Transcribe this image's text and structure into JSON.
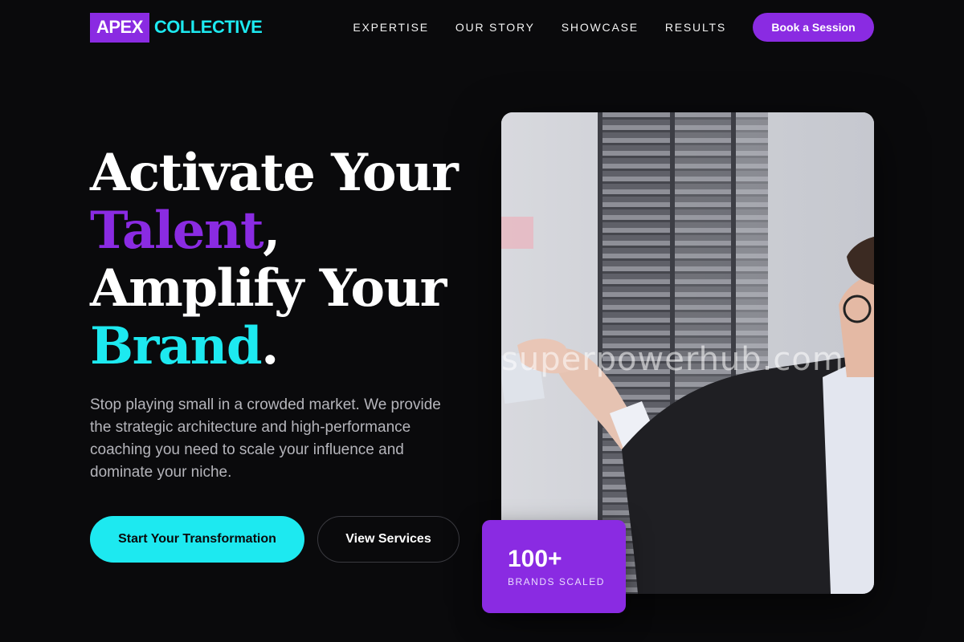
{
  "header": {
    "logo_box": "APEX",
    "logo_text": "COLLECTIVE",
    "nav": [
      {
        "label": "EXPERTISE"
      },
      {
        "label": "OUR STORY"
      },
      {
        "label": "SHOWCASE"
      },
      {
        "label": "RESULTS"
      }
    ],
    "cta_label": "Book a Session"
  },
  "hero": {
    "headline": {
      "line1": "Activate Your",
      "word_talent": "Talent",
      "comma": ",",
      "line3": "Amplify Your",
      "word_brand": "Brand",
      "period": "."
    },
    "subtext": "Stop playing small in a crowded market. We provide the strategic architecture and high-performance coaching you need to scale your influence and dominate your niche.",
    "primary_button": "Start Your Transformation",
    "secondary_button": "View Services",
    "image": {
      "watermark": "superpowerhub.com"
    },
    "stat": {
      "number": "100+",
      "label": "BRANDS SCALED"
    }
  },
  "colors": {
    "background": "#0a0a0c",
    "accent_purple": "#8a2be2",
    "accent_cyan": "#1de9f0",
    "body_text": "#b5b5bb"
  },
  "icons": {
    "hero_image": "woman-pointing-at-sticky-notes-photo"
  }
}
